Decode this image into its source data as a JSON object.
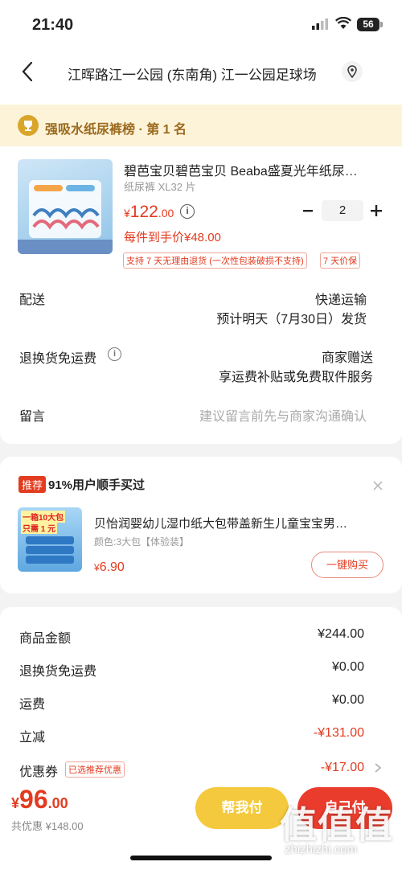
{
  "status": {
    "time": "21:40",
    "battery": "56"
  },
  "header": {
    "address": "江晖路江一公园 (东南角) 江一公园足球场"
  },
  "rank": {
    "text": "强吸水纸尿裤榜 · 第 1 名"
  },
  "product": {
    "title": "碧芭宝贝碧芭宝贝 Beaba盛夏光年纸尿…",
    "spec": "纸尿裤 XL32 片",
    "price_symbol": "¥",
    "price_int": "122",
    "price_dec": ".00",
    "quantity": "2",
    "unit_price": "每件到手价¥48.00",
    "tag_return": "支持 7 天无理由退货 (一次性包装破损不支持)",
    "tag_price": "7 天价保"
  },
  "delivery": {
    "label": "配送",
    "method": "快递运输",
    "eta": "预计明天（7月30日）发货"
  },
  "return_fee": {
    "label": "退换货免运费",
    "value1": "商家赠送",
    "value2": "享运费补贴或免费取件服务"
  },
  "message": {
    "label": "留言",
    "placeholder": "建议留言前先与商家沟通确认"
  },
  "recommend": {
    "badge": "推荐",
    "text": "91%用户顺手买过",
    "thumb_line1": "一箱10大包",
    "thumb_line2": "只需 1 元",
    "title": "贝怡润婴幼儿湿巾纸大包带盖新生儿童宝宝男…",
    "spec": "颜色:3大包【体验装】",
    "price_symbol": "¥",
    "price": "6.90",
    "button": "一键购买"
  },
  "summary": [
    {
      "label": "商品金额",
      "value": "¥244.00",
      "red": false
    },
    {
      "label": "退换货免运费",
      "value": "¥0.00",
      "red": false
    },
    {
      "label": "运费",
      "value": "¥0.00",
      "red": false
    },
    {
      "label": "立减",
      "value": "-¥131.00",
      "red": true
    }
  ],
  "coupon": {
    "label": "优惠券",
    "badge": "已选推荐优惠",
    "value": "-¥17.00"
  },
  "footer": {
    "price_symbol": "¥",
    "price_int": "96",
    "price_dec": ".00",
    "saved": "共优惠 ¥148.00",
    "help_pay": "帮我付",
    "self_pay": "自己付"
  },
  "watermark": "值值值",
  "watermark_url": "zhizhizhi.com",
  "colors": {
    "accent": "#e33b1f",
    "gold": "#f5c93d",
    "red_button": "#ea3c2d"
  }
}
